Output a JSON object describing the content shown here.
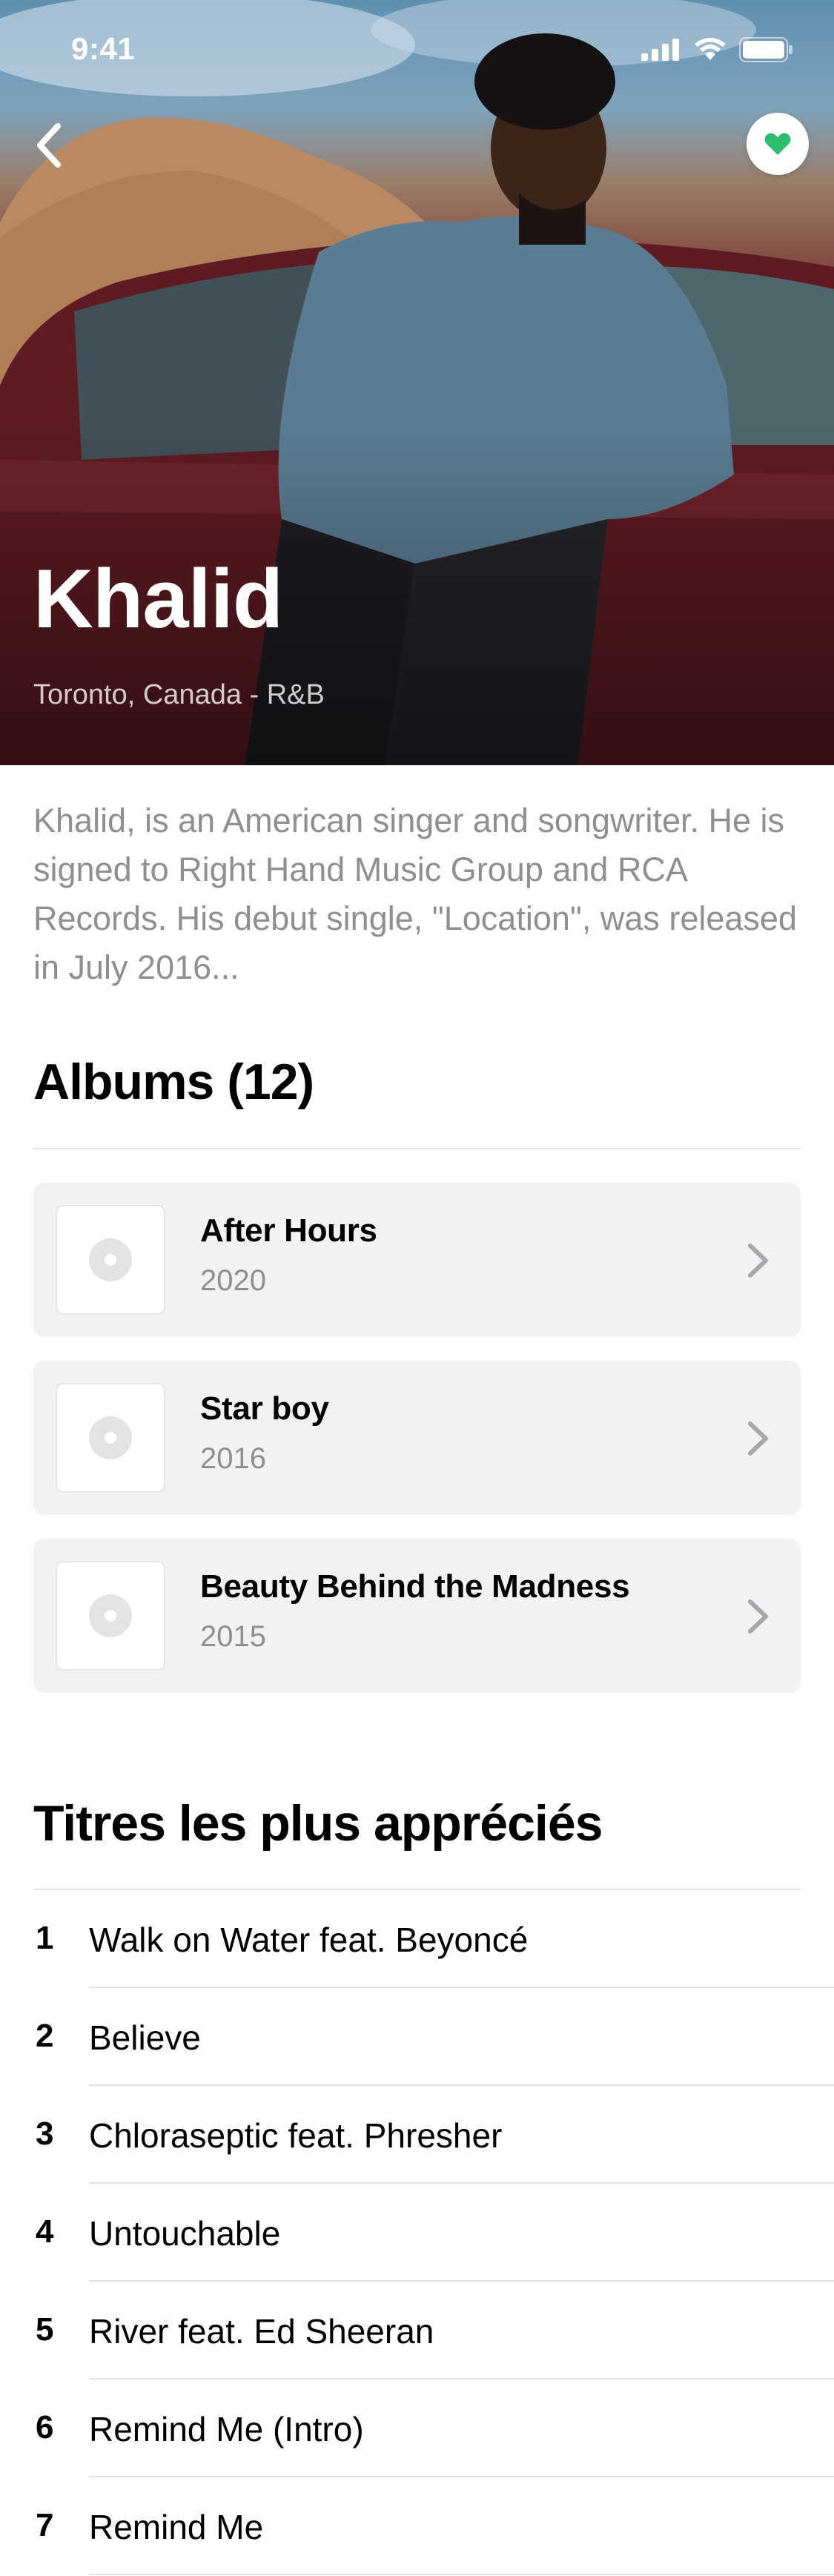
{
  "status_bar": {
    "time": "9:41"
  },
  "artist": {
    "name": "Khalid",
    "meta": "Toronto, Canada - R&B",
    "bio": "Khalid, is an American singer and songwriter. He is signed to Right Hand Music Group and RCA Records. His debut single, \"Location\", was released in July 2016..."
  },
  "colors": {
    "accent": "#2dbd6e",
    "card_bg": "#f2f2f2",
    "muted": "#8e8e93"
  },
  "albums": {
    "title": "Albums (12)",
    "items": [
      {
        "title": "After Hours",
        "year": "2020"
      },
      {
        "title": "Star boy",
        "year": "2016"
      },
      {
        "title": "Beauty Behind the Madness",
        "year": "2015"
      }
    ]
  },
  "tracks": {
    "title": "Titres les plus appréciés",
    "items": [
      {
        "num": "1",
        "title": "Walk on Water feat. Beyoncé"
      },
      {
        "num": "2",
        "title": "Believe"
      },
      {
        "num": "3",
        "title": "Chloraseptic feat. Phresher"
      },
      {
        "num": "4",
        "title": "Untouchable"
      },
      {
        "num": "5",
        "title": "River feat. Ed Sheeran"
      },
      {
        "num": "6",
        "title": "Remind Me (Intro)"
      },
      {
        "num": "7",
        "title": "Remind Me"
      }
    ]
  }
}
